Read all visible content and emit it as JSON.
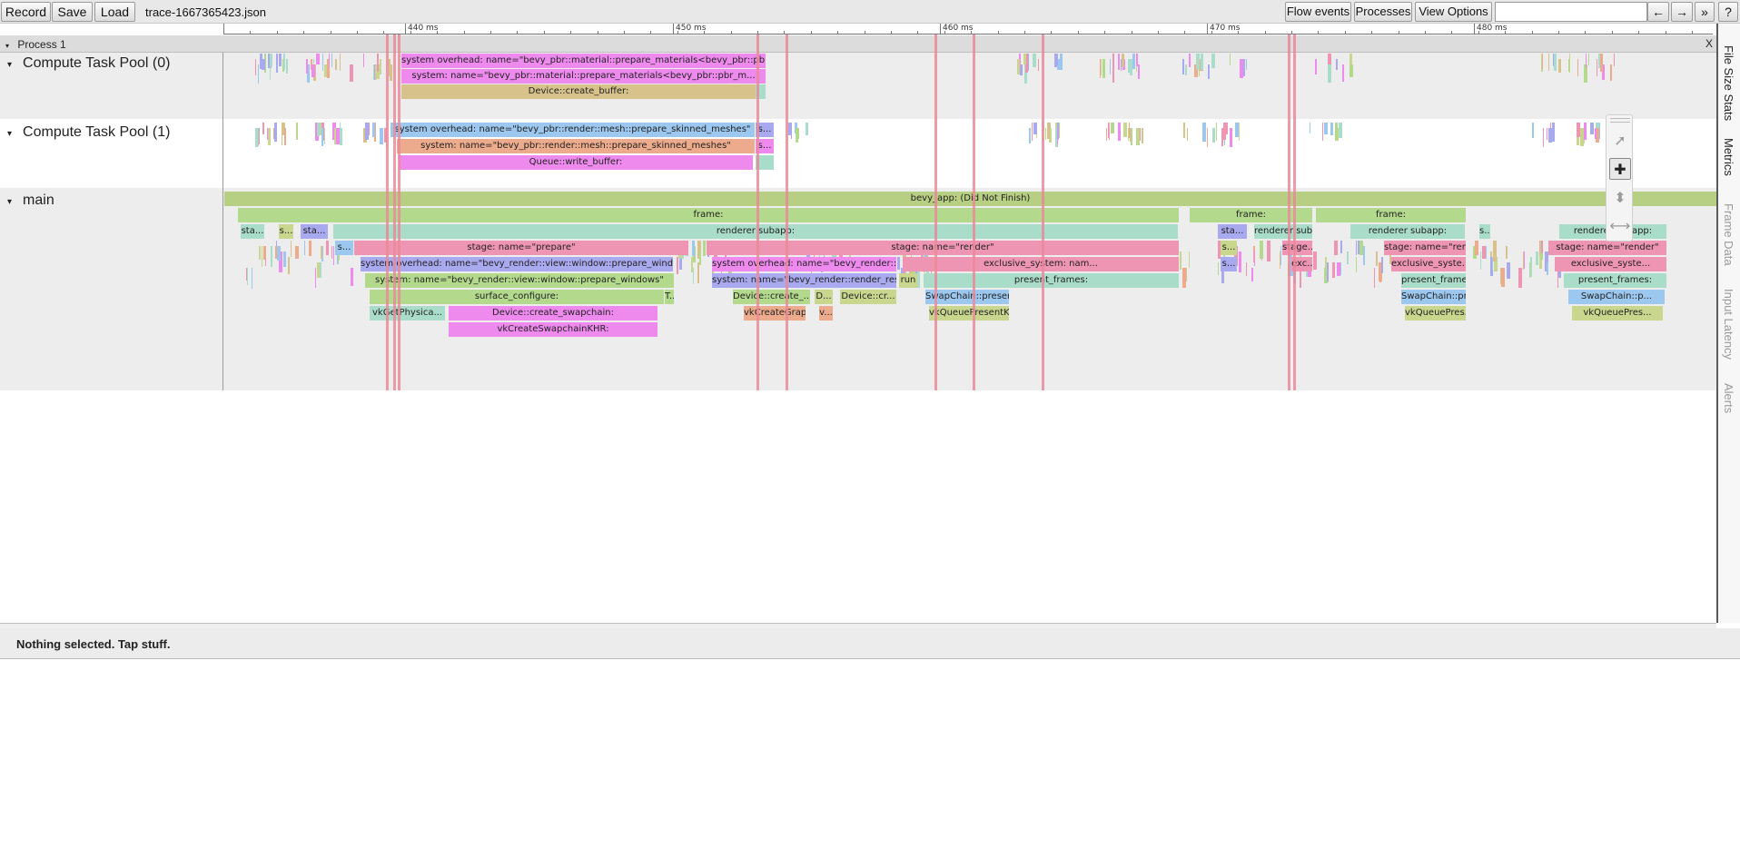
{
  "toolbar": {
    "record_label": "Record",
    "save_label": "Save",
    "load_label": "Load",
    "filename": "trace-1667365423.json",
    "flow_events_label": "Flow events",
    "processes_label": "Processes",
    "view_options_label": "View Options",
    "search_placeholder": "",
    "prev_label": "←",
    "next_label": "→",
    "more_label": "»",
    "help_label": "?"
  },
  "ruler": {
    "labels": [
      "440 ms",
      "450 ms",
      "460 ms",
      "470 ms",
      "480 ms"
    ]
  },
  "process": {
    "title": "Process 1",
    "close_label": "X",
    "expand_icon": "triangle-down-icon"
  },
  "tracks": [
    {
      "name": "Compute Task Pool (0)",
      "slices": [
        "system overhead: name=\"bevy_pbr::material::prepare_materials<bevy_pbr::pbr...",
        "system: name=\"bevy_pbr::material::prepare_materials<bevy_pbr::pbr_m...",
        "Device::create_buffer:"
      ]
    },
    {
      "name": "Compute Task Pool (1)",
      "slices": [
        "system overhead: name=\"bevy_pbr::render::mesh::prepare_skinned_meshes\"",
        "s...",
        "system: name=\"bevy_pbr::render::mesh::prepare_skinned_meshes\"",
        "s...",
        "Queue::write_buffer:"
      ]
    },
    {
      "name": "main",
      "slices": {
        "bevy_app": "bevy_app:  (Did Not Finish)",
        "frame1": "frame:",
        "frame2": "frame:",
        "frame3": "frame:",
        "sta1": "sta...",
        "s1": "s...",
        "sta2": "sta...",
        "renderer_subapp1": "renderer subapp:",
        "renderer_subapp2": "renderer subapp:",
        "renderer_subapp3": "renderer subapp:",
        "renderer_subapp4": "renderer subapp:",
        "sta3": "sta...",
        "s2": "s...",
        "s3": "s...",
        "s4": "s...",
        "s5": "s...",
        "stage_prepare": "stage: name=\"prepare\"",
        "stage_render1": "stage: name=\"render\"",
        "stage_render2": "stage...",
        "stage_render3": "stage: name=\"render\"",
        "stage_render4": "stage: name=\"render\"",
        "so_windows": "system overhead: name=\"bevy_render::view::window::prepare_windows\"",
        "so_render_r": "system overhead: name=\"bevy_render::render_r...",
        "excl1": "exclusive_system: nam...",
        "exc2": "exc...",
        "excl3": "exclusive_syste...",
        "excl4": "exclusive_syste...",
        "sys_windows": "system: name=\"bevy_render::view::window::prepare_windows\"",
        "sys_render_resour": "system: name=\"bevy_render::render_resour...",
        "run": "run",
        "present1": "present_frames:",
        "present2": "present_frames:",
        "present3": "present_frames:",
        "surface_configure": "surface_configure:",
        "t1": "T...",
        "device_create": "Device::create_...",
        "d1": "D...",
        "device_cr": "Device::cr...",
        "swapchain_present1": "SwapChain::present:",
        "swapchain_present2": "SwapChain::present:",
        "swapchain_present3": "SwapChain::p...",
        "vkgetphysica": "vkGetPhysica...",
        "device_create_swapchain": "Device::create_swapchain:",
        "vkcreategrap": "vkCreateGrap...",
        "v1": "v...",
        "vkqueuepresent1": "vkQueuePresentKHR:",
        "vkqueuepres2": "vkQueuePres...",
        "vkqueuepres3": "vkQueuePres...",
        "vkcreateswapchain": "vkCreateSwapchainKHR:"
      }
    }
  ],
  "tools": {
    "select_icon": "cursor-arrow-icon",
    "pan_icon": "move-cross-icon",
    "zoom_icon": "zoom-updown-icon",
    "timing_icon": "timing-range-icon"
  },
  "side_tabs": [
    "File Size Stats",
    "Metrics",
    "Frame Data",
    "Input Latency",
    "Alerts"
  ],
  "detail": {
    "status": "Nothing selected. Tap stuff."
  },
  "colors": {
    "pink": "#ee8aee",
    "blue": "#9cc7ef",
    "green": "#b3d98c",
    "lime": "#b7cf82",
    "teal": "#a9dcc9",
    "purple": "#a9a9ef",
    "rose": "#ee95b4",
    "salmon": "#ecab8c",
    "tan": "#d6c28a",
    "olive": "#c8d68e",
    "marker": "#ea8a99"
  }
}
